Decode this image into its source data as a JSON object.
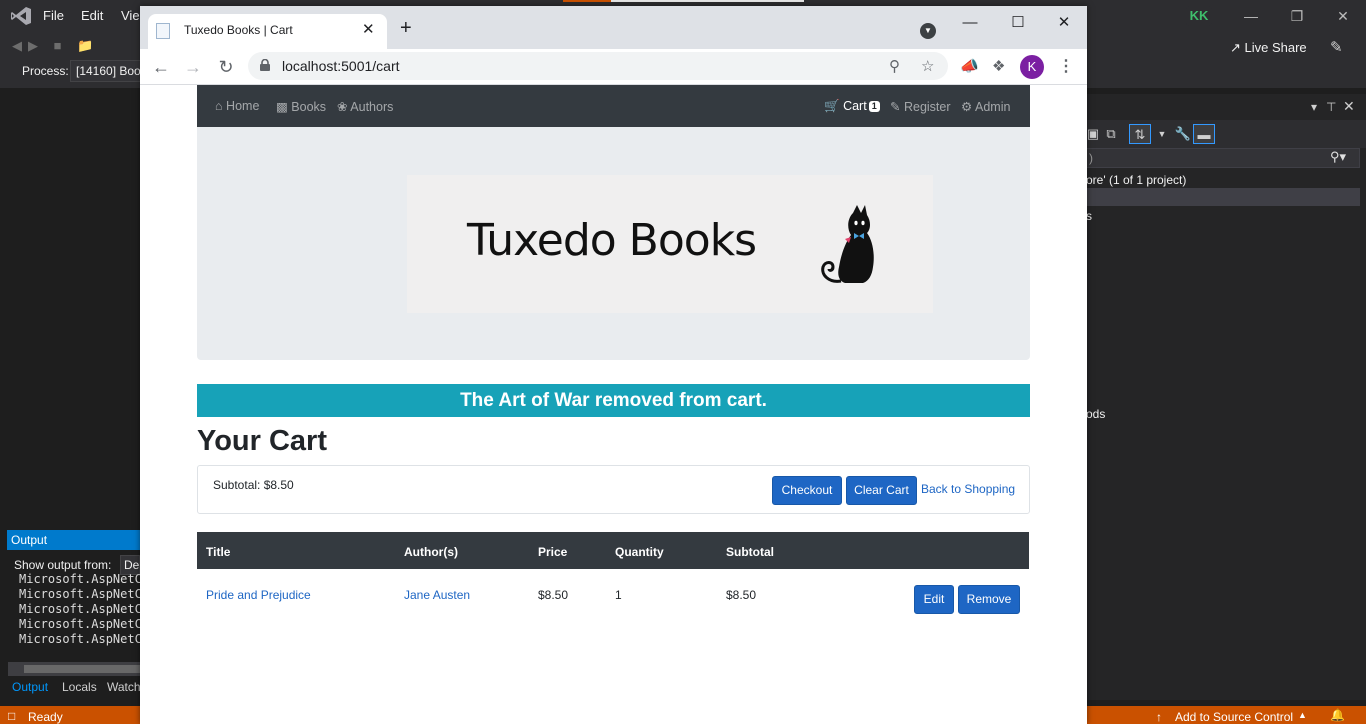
{
  "vs": {
    "menu": [
      "File",
      "Edit",
      "Vie"
    ],
    "account_initials": "KK",
    "live_share": "Live Share",
    "process_label": "Process:",
    "process_value": "[14160] Boo",
    "solution_line": "ore' (1 of 1 project)",
    "solution_item_s": "s",
    "solution_item_ods": "ods",
    "search_placeholder": ")",
    "output": {
      "title": "Output",
      "show_from_label": "Show output from:",
      "show_from_value": "De",
      "lines": [
        "Microsoft.AspNetC",
        "Microsoft.AspNetC",
        "Microsoft.AspNetC",
        "Microsoft.AspNetC",
        "Microsoft.AspNetC"
      ]
    },
    "bottom_tabs": [
      "Output",
      "Locals",
      "Watch"
    ],
    "status": {
      "ready": "Ready",
      "source_control": "Add to Source Control"
    }
  },
  "browser": {
    "tab_title": "Tuxedo Books | Cart",
    "url": "localhost:5001/cart",
    "profile_initial": "K"
  },
  "page": {
    "nav": {
      "home": "Home",
      "books": "Books",
      "authors": "Authors",
      "cart": "Cart",
      "cart_count": "1",
      "register": "Register",
      "admin": "Admin"
    },
    "logo_text": "Tuxedo Books",
    "alert": "The Art of War removed from cart.",
    "title": "Your Cart",
    "subtotal": "Subtotal: $8.50",
    "buttons": {
      "checkout": "Checkout",
      "clear_cart": "Clear Cart",
      "back_to_shopping": "Back to Shopping",
      "edit": "Edit",
      "remove": "Remove"
    },
    "table": {
      "headers": [
        "Title",
        "Author(s)",
        "Price",
        "Quantity",
        "Subtotal"
      ],
      "rows": [
        {
          "title": "Pride and Prejudice",
          "author": "Jane Austen",
          "price": "$8.50",
          "quantity": "1",
          "subtotal": "$8.50"
        }
      ]
    }
  },
  "colors": {
    "vs_accent": "#007acc",
    "vs_status": "#ca5100",
    "navbar": "#343a40",
    "alert_info": "#17a2b8",
    "primary_button": "#1e66c4"
  }
}
